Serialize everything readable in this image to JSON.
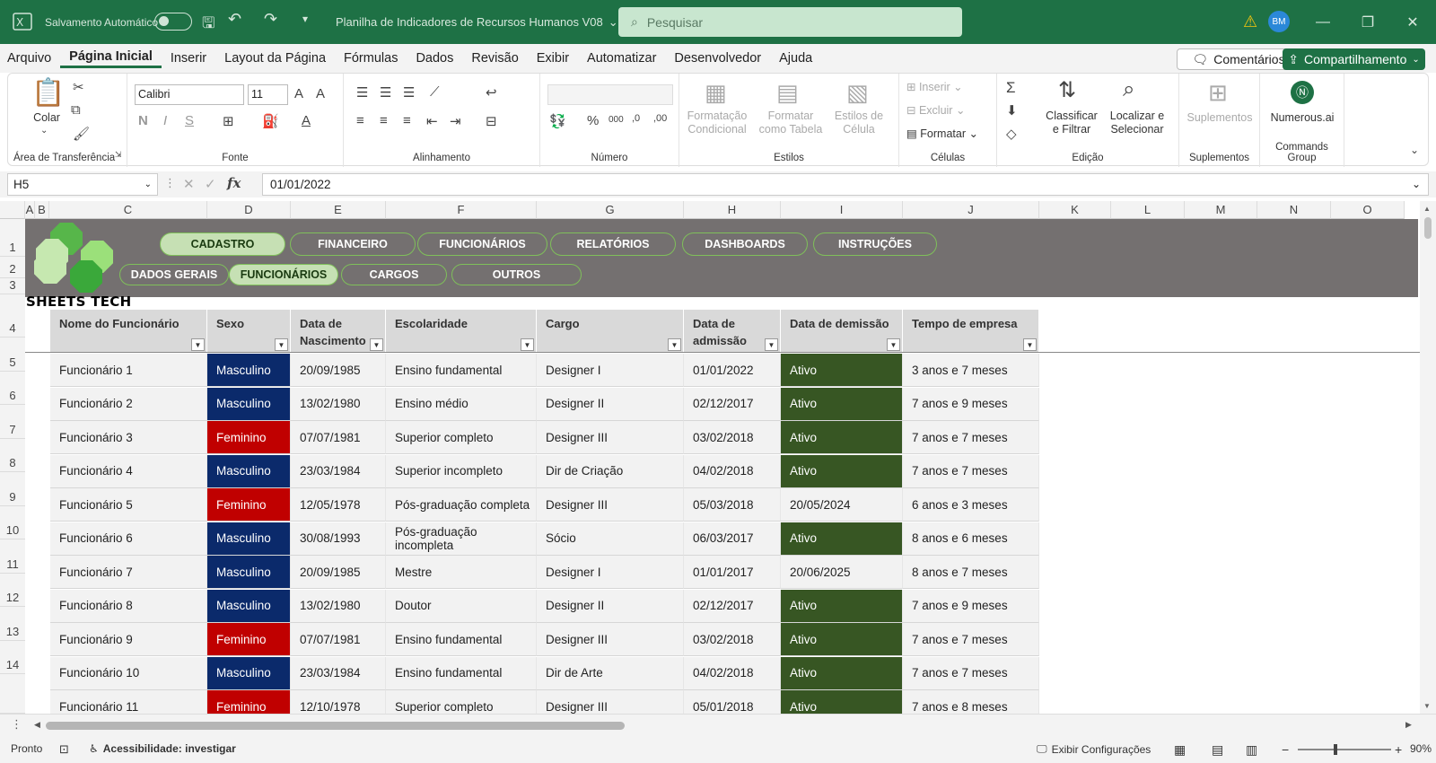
{
  "titlebar": {
    "autosave_label": "Salvamento Automático",
    "doc_title": "Planilha de Indicadores de Recursos Humanos V08",
    "search_placeholder": "Pesquisar",
    "avatar_initials": "BM"
  },
  "menu": [
    "Arquivo",
    "Página Inicial",
    "Inserir",
    "Layout da Página",
    "Fórmulas",
    "Dados",
    "Revisão",
    "Exibir",
    "Automatizar",
    "Desenvolvedor",
    "Ajuda"
  ],
  "menu_active": "Página Inicial",
  "comments_label": "Comentários",
  "share_label": "Compartilhamento",
  "ribbon": {
    "clipboard": {
      "paste": "Colar",
      "label": "Área de Transferência"
    },
    "font": {
      "name": "Calibri",
      "size": "11",
      "label": "Fonte"
    },
    "alignment": {
      "label": "Alinhamento"
    },
    "number": {
      "label": "Número"
    },
    "styles": {
      "cond": "Formatação Condicional",
      "table": "Formatar como Tabela",
      "cell": "Estilos de Célula",
      "label": "Estilos"
    },
    "cells": {
      "insert": "Inserir",
      "delete": "Excluir",
      "format": "Formatar",
      "label": "Células"
    },
    "editing": {
      "sort": "Classificar e Filtrar",
      "find": "Localizar e Selecionar",
      "label": "Edição"
    },
    "addins": {
      "btn": "Suplementos",
      "label": "Suplementos"
    },
    "commands": {
      "btn": "Numerous.ai",
      "label": "Commands Group"
    }
  },
  "formula": {
    "cell_ref": "H5",
    "value": "01/01/2022",
    "fx": "fx"
  },
  "columns": [
    "A",
    "B",
    "C",
    "D",
    "E",
    "F",
    "G",
    "H",
    "I",
    "J",
    "K",
    "L",
    "M",
    "N",
    "O"
  ],
  "rows": [
    "1",
    "2",
    "3",
    "4",
    "5",
    "6",
    "7",
    "8",
    "9",
    "10",
    "11",
    "12",
    "13",
    "14"
  ],
  "nav_top": [
    "CADASTRO",
    "FINANCEIRO",
    "FUNCIONÁRIOS",
    "RELATÓRIOS",
    "DASHBOARDS",
    "INSTRUÇÕES"
  ],
  "nav_sub": [
    "DADOS GERAIS",
    "FUNCIONÁRIOS",
    "CARGOS",
    "OUTROS"
  ],
  "brand": "SHEETS TECH",
  "table_headers": [
    "Nome do Funcionário",
    "Sexo",
    "Data de Nascimento",
    "Escolaridade",
    "Cargo",
    "Data de admissão",
    "Data de demissão",
    "Tempo de empresa"
  ],
  "table_rows": [
    [
      "Funcionário 1",
      "Masculino",
      "20/09/1985",
      "Ensino fundamental",
      "Designer I",
      "01/01/2022",
      "Ativo",
      "3 anos e 7 meses"
    ],
    [
      "Funcionário 2",
      "Masculino",
      "13/02/1980",
      "Ensino médio",
      "Designer II",
      "02/12/2017",
      "Ativo",
      "7 anos e 9 meses"
    ],
    [
      "Funcionário 3",
      "Feminino",
      "07/07/1981",
      "Superior completo",
      "Designer III",
      "03/02/2018",
      "Ativo",
      "7 anos e 7 meses"
    ],
    [
      "Funcionário 4",
      "Masculino",
      "23/03/1984",
      "Superior incompleto",
      "Dir de Criação",
      "04/02/2018",
      "Ativo",
      "7 anos e 7 meses"
    ],
    [
      "Funcionário 5",
      "Feminino",
      "12/05/1978",
      "Pós-graduação completa",
      "Designer III",
      "05/03/2018",
      "20/05/2024",
      "6 anos e 3 meses"
    ],
    [
      "Funcionário 6",
      "Masculino",
      "30/08/1993",
      "Pós-graduação incompleta",
      "Sócio",
      "06/03/2017",
      "Ativo",
      "8 anos e 6 meses"
    ],
    [
      "Funcionário 7",
      "Masculino",
      "20/09/1985",
      "Mestre",
      "Designer I",
      "01/01/2017",
      "20/06/2025",
      "8 anos e 7 meses"
    ],
    [
      "Funcionário 8",
      "Masculino",
      "13/02/1980",
      "Doutor",
      "Designer II",
      "02/12/2017",
      "Ativo",
      "7 anos e 9 meses"
    ],
    [
      "Funcionário 9",
      "Feminino",
      "07/07/1981",
      "Ensino fundamental",
      "Designer III",
      "03/02/2018",
      "Ativo",
      "7 anos e 7 meses"
    ],
    [
      "Funcionário 10",
      "Masculino",
      "23/03/1984",
      "Ensino fundamental",
      "Dir de Arte",
      "04/02/2018",
      "Ativo",
      "7 anos e 7 meses"
    ],
    [
      "Funcionário 11",
      "Feminino",
      "12/10/1978",
      "Superior completo",
      "Designer III",
      "05/01/2018",
      "Ativo",
      "7 anos e 8 meses"
    ]
  ],
  "status": {
    "ready": "Pronto",
    "accessibility": "Acessibilidade: investigar",
    "display_settings": "Exibir Configurações",
    "zoom": "90%"
  },
  "colors": {
    "title_bar": "#1e7145",
    "male": "#0b2a6b",
    "female": "#c00000",
    "active": "#375623",
    "banner": "#747070"
  }
}
